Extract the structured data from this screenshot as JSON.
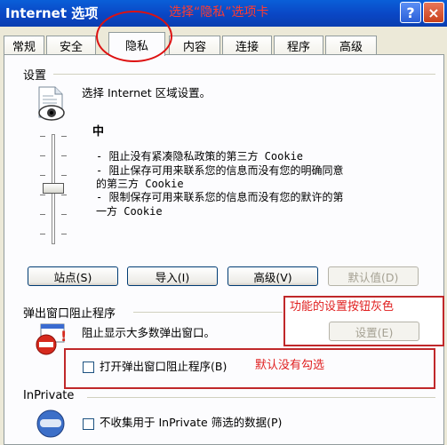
{
  "window": {
    "title": "Internet 选项",
    "title_annotation": "选择“隐私”选项卡",
    "help_icon": "?",
    "close_icon": "×"
  },
  "tabs": [
    {
      "label": "常规",
      "active": false
    },
    {
      "label": "安全",
      "active": false
    },
    {
      "label": "隐私",
      "active": true
    },
    {
      "label": "内容",
      "active": false
    },
    {
      "label": "连接",
      "active": false
    },
    {
      "label": "程序",
      "active": false
    },
    {
      "label": "高级",
      "active": false
    }
  ],
  "settings": {
    "section_label": "设置",
    "intro": "选择 Internet 区域设置。",
    "level_title": "中",
    "description_lines": [
      "- 阻止没有紧凑隐私政策的第三方 Cookie",
      "- 阻止保存可用来联系您的信息而没有您的明确同意",
      "的第三方 Cookie",
      "- 限制保存可用来联系您的信息而没有您的默许的第",
      "一方 Cookie"
    ],
    "slider_level": 0.5,
    "buttons": {
      "sites": "站点(S)",
      "import": "导入(I)",
      "advanced": "高级(V)",
      "default": "默认值(D)"
    }
  },
  "popup_blocker": {
    "section_label": "弹出窗口阻止程序",
    "desc": "阻止显示大多数弹出窗口。",
    "settings_button": "设置(E)",
    "checkbox_label": "打开弹出窗口阻止程序(B)",
    "checkbox_checked": false,
    "annotation_settings_gray": "功能的设置按钮灰色",
    "annotation_unchecked": "默认没有勾选"
  },
  "inprivate": {
    "section_label": "InPrivate",
    "checkbox_label": "不收集用于 InPrivate 筛选的数据(P)",
    "checkbox_checked": false
  },
  "colors": {
    "titlebar": "#0a46c4",
    "annotation": "#e02020"
  }
}
